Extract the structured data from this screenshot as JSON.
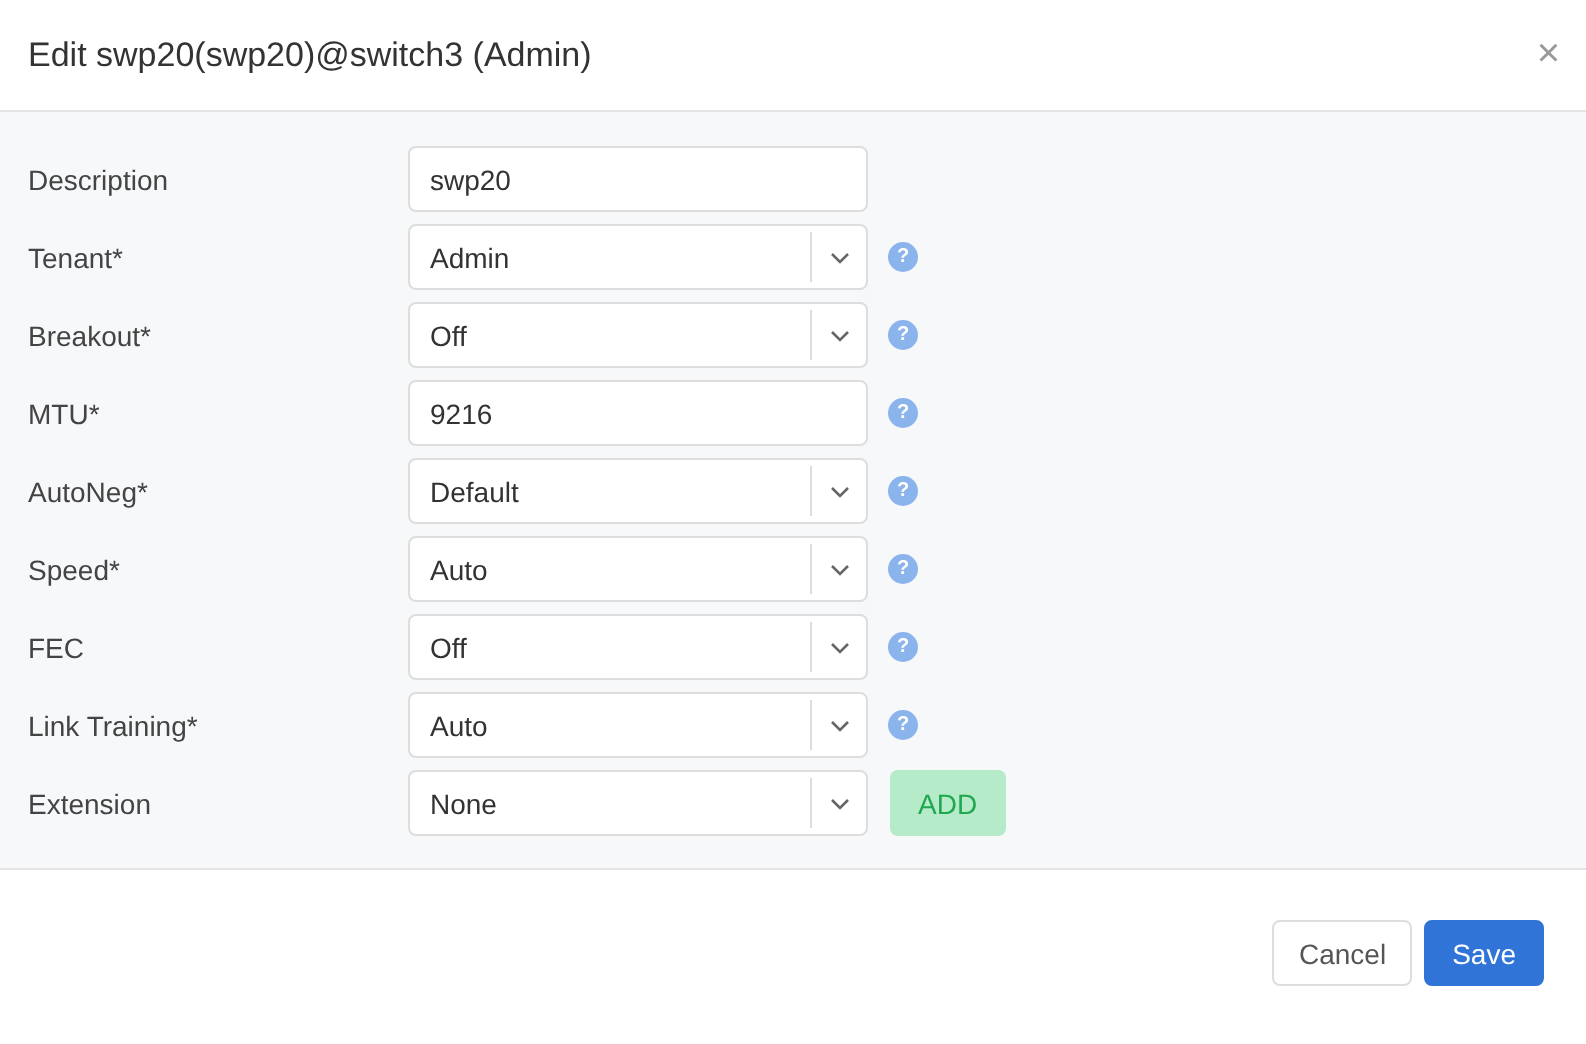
{
  "dialog": {
    "title": "Edit swp20(swp20)@switch3 (Admin)",
    "close": "×"
  },
  "fields": [
    {
      "label": "Description",
      "kind": "text",
      "value": "swp20"
    },
    {
      "label": "Tenant*",
      "kind": "select",
      "value": "Admin",
      "help": "?"
    },
    {
      "label": "Breakout*",
      "kind": "select",
      "value": "Off",
      "help": "?"
    },
    {
      "label": "MTU*",
      "kind": "text",
      "value": "9216",
      "help": "?"
    },
    {
      "label": "AutoNeg*",
      "kind": "select",
      "value": "Default",
      "help": "?"
    },
    {
      "label": "Speed*",
      "kind": "select",
      "value": "Auto",
      "help": "?"
    },
    {
      "label": "FEC",
      "kind": "select",
      "value": "Off",
      "help": "?"
    },
    {
      "label": "Link Training*",
      "kind": "select",
      "value": "Auto",
      "help": "?"
    },
    {
      "label": "Extension",
      "kind": "select",
      "value": "None",
      "action": "ADD"
    }
  ],
  "buttons": [
    {
      "label": "Cancel",
      "kind": "secondary"
    },
    {
      "label": "Save",
      "kind": "primary"
    }
  ]
}
